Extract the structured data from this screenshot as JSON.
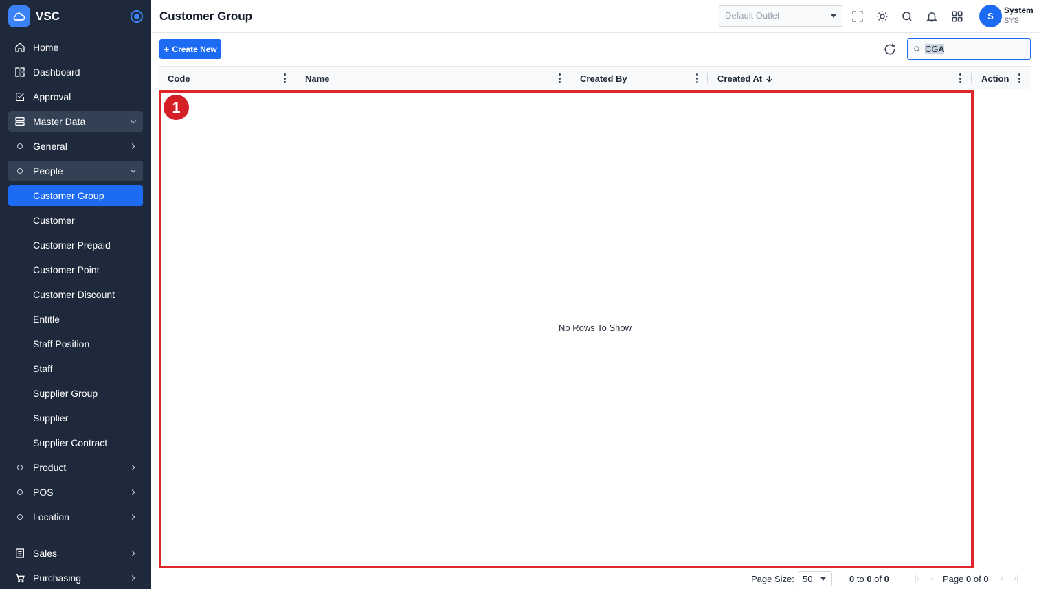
{
  "app": {
    "name": "VSC"
  },
  "colors": {
    "sidebar_bg": "#1e293b",
    "accent": "#1d6bf3",
    "highlight": "#e0262b"
  },
  "sidebar": {
    "items": [
      {
        "label": "Home",
        "icon": "home-icon"
      },
      {
        "label": "Dashboard",
        "icon": "dashboard-icon"
      },
      {
        "label": "Approval",
        "icon": "approval-icon"
      },
      {
        "label": "Master Data",
        "icon": "server-icon",
        "expanded": true
      },
      {
        "label": "General",
        "icon": "circle-icon"
      },
      {
        "label": "People",
        "icon": "circle-icon",
        "expanded": true
      },
      {
        "label": "Customer Group",
        "active": true
      },
      {
        "label": "Customer"
      },
      {
        "label": "Customer Prepaid"
      },
      {
        "label": "Customer Point"
      },
      {
        "label": "Customer Discount"
      },
      {
        "label": "Entitle"
      },
      {
        "label": "Staff Position"
      },
      {
        "label": "Staff"
      },
      {
        "label": "Supplier Group"
      },
      {
        "label": "Supplier"
      },
      {
        "label": "Supplier Contract"
      },
      {
        "label": "Product",
        "icon": "circle-icon"
      },
      {
        "label": "POS",
        "icon": "circle-icon"
      },
      {
        "label": "Location",
        "icon": "circle-icon"
      },
      {
        "label": "Sales",
        "icon": "sales-icon"
      },
      {
        "label": "Purchasing",
        "icon": "cart-icon"
      }
    ]
  },
  "header": {
    "title": "Customer Group",
    "outlet_placeholder": "Default Outlet",
    "user": {
      "initial": "S",
      "name": "System",
      "code": "SYS"
    }
  },
  "toolbar": {
    "create_label": "Create New",
    "search_value": "CGA"
  },
  "grid": {
    "columns": [
      "Code",
      "Name",
      "Created By",
      "Created At",
      "Action"
    ],
    "sort": {
      "column": "Created At",
      "direction": "desc"
    },
    "empty_message": "No Rows To Show"
  },
  "annotation": {
    "badge": "1"
  },
  "footer": {
    "page_size_label": "Page Size:",
    "page_size": "50",
    "range_from": "0",
    "range_to": "0",
    "range_total": "0",
    "page_word": "Page",
    "page_current": "0",
    "page_total": "0"
  }
}
